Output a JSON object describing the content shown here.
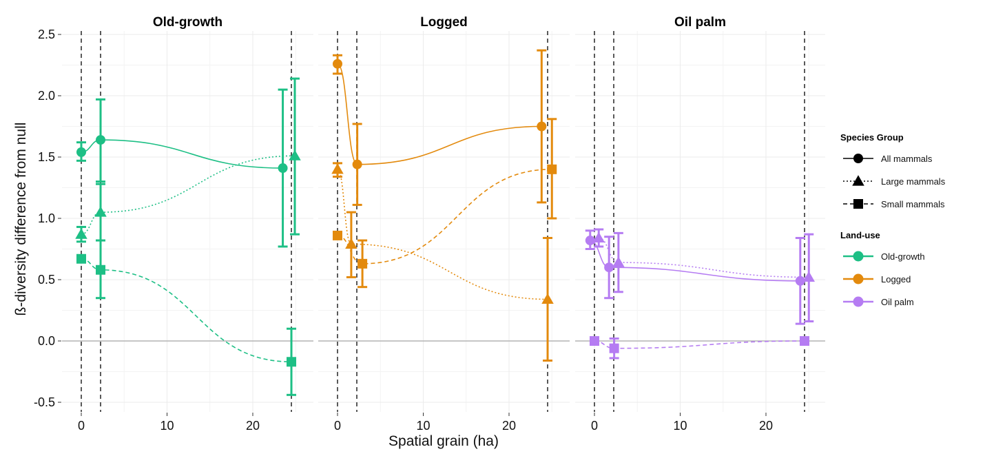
{
  "chart_data": {
    "type": "line",
    "title": "",
    "xlabel": "Spatial grain (ha)",
    "ylabel": "ß-diversity difference from null",
    "ylim": [
      -0.6,
      2.55
    ],
    "xlim": [
      -2.2,
      27.2
    ],
    "yticks": [
      -0.5,
      0.0,
      0.5,
      1.0,
      1.5,
      2.0,
      2.5
    ],
    "ytick_labels": [
      "-0.5",
      "0.0",
      "0.5",
      "1.0",
      "1.5",
      "2.0",
      "2.5"
    ],
    "xticks": [
      0,
      10,
      20
    ],
    "xtick_labels": [
      "0",
      "10",
      "20"
    ],
    "grid": true,
    "reference_vlines": [
      0,
      2.25,
      24.5
    ],
    "reference_hline": 0,
    "legend_position": "right",
    "colors": {
      "Old-growth": "#1dbf85",
      "Logged": "#e38a0d",
      "Oil palm": "#b57cf2"
    },
    "legend": {
      "species_title": "Species Group",
      "species": [
        {
          "label": "All mammals",
          "shape": "circle",
          "line": "solid"
        },
        {
          "label": "Large mammals",
          "shape": "triangle",
          "line": "dotted"
        },
        {
          "label": "Small mammals",
          "shape": "square",
          "line": "dashed"
        }
      ],
      "landuse_title": "Land-use",
      "landuse": [
        {
          "label": "Old-growth"
        },
        {
          "label": "Logged"
        },
        {
          "label": "Oil palm"
        }
      ]
    },
    "panels": [
      {
        "name": "Old-growth",
        "series": [
          {
            "group": "All mammals",
            "points": [
              {
                "x": 0,
                "y": 1.54,
                "lo": 1.47,
                "hi": 1.62
              },
              {
                "x": 2.25,
                "y": 1.64,
                "lo": 1.3,
                "hi": 1.97
              },
              {
                "x": 23.5,
                "y": 1.41,
                "lo": 0.77,
                "hi": 2.05
              }
            ]
          },
          {
            "group": "Large mammals",
            "points": [
              {
                "x": 0,
                "y": 0.87,
                "lo": 0.81,
                "hi": 0.93
              },
              {
                "x": 2.25,
                "y": 1.05,
                "lo": 0.82,
                "hi": 1.28
              },
              {
                "x": 24.9,
                "y": 1.51,
                "lo": 0.87,
                "hi": 2.14
              }
            ]
          },
          {
            "group": "Small mammals",
            "points": [
              {
                "x": 0,
                "y": 0.67,
                "lo": 0.67,
                "hi": 0.67
              },
              {
                "x": 2.25,
                "y": 0.58,
                "lo": 0.35,
                "hi": 0.82
              },
              {
                "x": 24.5,
                "y": -0.17,
                "lo": -0.44,
                "hi": 0.1
              }
            ]
          }
        ]
      },
      {
        "name": "Logged",
        "series": [
          {
            "group": "All mammals",
            "points": [
              {
                "x": 0,
                "y": 2.26,
                "lo": 2.18,
                "hi": 2.33
              },
              {
                "x": 2.3,
                "y": 1.44,
                "lo": 1.11,
                "hi": 1.77
              },
              {
                "x": 23.8,
                "y": 1.75,
                "lo": 1.13,
                "hi": 2.37
              }
            ]
          },
          {
            "group": "Large mammals",
            "points": [
              {
                "x": 0,
                "y": 1.4,
                "lo": 1.34,
                "hi": 1.45
              },
              {
                "x": 1.6,
                "y": 0.79,
                "lo": 0.52,
                "hi": 1.05
              },
              {
                "x": 24.5,
                "y": 0.34,
                "lo": -0.16,
                "hi": 0.84
              }
            ]
          },
          {
            "group": "Small mammals",
            "points": [
              {
                "x": 0,
                "y": 0.86,
                "lo": 0.86,
                "hi": 0.86
              },
              {
                "x": 2.9,
                "y": 0.63,
                "lo": 0.44,
                "hi": 0.82
              },
              {
                "x": 25.0,
                "y": 1.4,
                "lo": 1.0,
                "hi": 1.81
              }
            ]
          }
        ]
      },
      {
        "name": "Oil palm",
        "series": [
          {
            "group": "All mammals",
            "points": [
              {
                "x": -0.5,
                "y": 0.82,
                "lo": 0.75,
                "hi": 0.9
              },
              {
                "x": 1.7,
                "y": 0.6,
                "lo": 0.35,
                "hi": 0.85
              },
              {
                "x": 24.0,
                "y": 0.49,
                "lo": 0.14,
                "hi": 0.84
              }
            ]
          },
          {
            "group": "Large mammals",
            "points": [
              {
                "x": 0.5,
                "y": 0.84,
                "lo": 0.77,
                "hi": 0.91
              },
              {
                "x": 2.8,
                "y": 0.64,
                "lo": 0.4,
                "hi": 0.88
              },
              {
                "x": 25.0,
                "y": 0.52,
                "lo": 0.16,
                "hi": 0.87
              }
            ]
          },
          {
            "group": "Small mammals",
            "points": [
              {
                "x": 0,
                "y": 0.0,
                "lo": 0.0,
                "hi": 0.0
              },
              {
                "x": 2.3,
                "y": -0.06,
                "lo": -0.14,
                "hi": 0.02
              },
              {
                "x": 24.5,
                "y": 0.0,
                "lo": 0.0,
                "hi": 0.0
              }
            ]
          }
        ]
      }
    ]
  }
}
